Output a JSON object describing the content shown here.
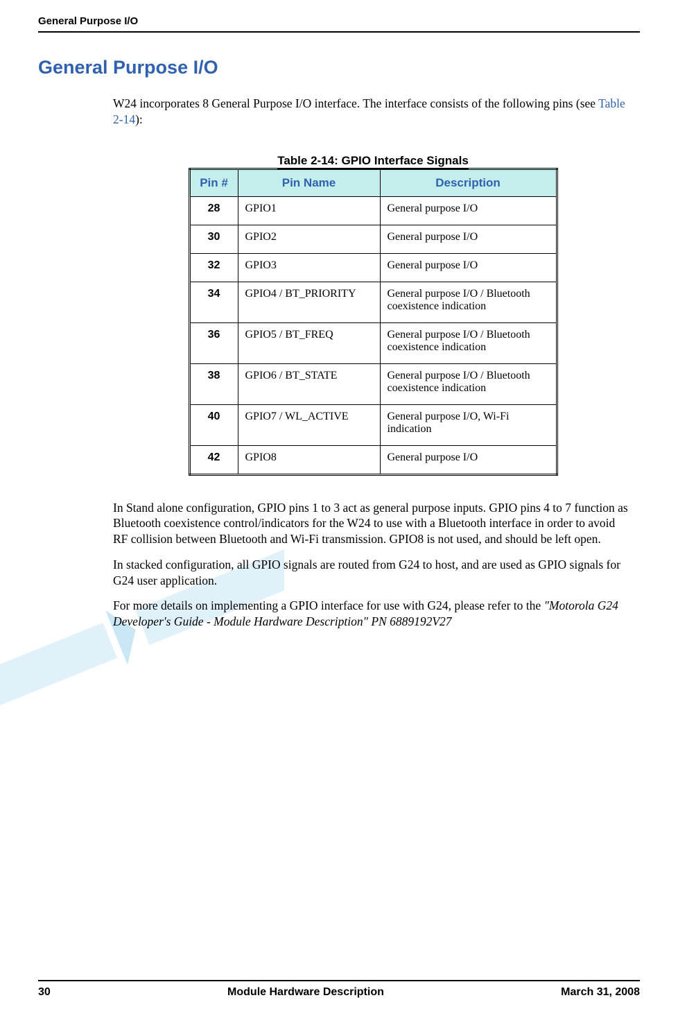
{
  "header": {
    "title": "General Purpose I/O"
  },
  "section": {
    "heading": "General Purpose I/O",
    "intro_pre": "W24 incorporates 8 General Purpose I/O interface. The interface consists of the following pins (see ",
    "intro_link": "Table 2-14",
    "intro_post": "):",
    "para1": "In Stand alone configuration, GPIO pins 1 to 3 act as general purpose inputs. GPIO pins 4 to 7 function as Bluetooth coexistence control/indicators for the W24 to use with a Bluetooth interface in order to avoid RF collision between Bluetooth and Wi-Fi transmission. GPIO8 is not used, and should be left open.",
    "para2": "In stacked configuration, all GPIO signals are routed from G24 to host, and are used as GPIO signals for G24 user application.",
    "para3_pre": "For more details on implementing a GPIO interface for use with G24, please refer to the ",
    "para3_italic": "\"Motorola G24 Developer's Guide - Module Hardware Description\" PN 6889192V27"
  },
  "table": {
    "caption": "Table 2-14: GPIO Interface Signals",
    "headers": {
      "pin": "Pin #",
      "name": "Pin Name",
      "desc": "Description"
    },
    "rows": [
      {
        "pin": "28",
        "name": "GPIO1",
        "desc": "General purpose I/O"
      },
      {
        "pin": "30",
        "name": "GPIO2",
        "desc": "General purpose I/O"
      },
      {
        "pin": "32",
        "name": "GPIO3",
        "desc": "General purpose I/O"
      },
      {
        "pin": "34",
        "name": "GPIO4 / BT_PRIORITY",
        "desc": "General purpose I/O / Bluetooth coexistence indication"
      },
      {
        "pin": "36",
        "name": "GPIO5 / BT_FREQ",
        "desc": "General purpose I/O / Bluetooth coexistence indication"
      },
      {
        "pin": "38",
        "name": "GPIO6 / BT_STATE",
        "desc": "General purpose I/O / Bluetooth coexistence indication"
      },
      {
        "pin": "40",
        "name": "GPIO7 / WL_ACTIVE",
        "desc": "General purpose I/O, Wi-Fi indication"
      },
      {
        "pin": "42",
        "name": "GPIO8",
        "desc": "General purpose I/O"
      }
    ]
  },
  "footer": {
    "page": "30",
    "center": "Module Hardware Description",
    "date": "March 31, 2008"
  }
}
